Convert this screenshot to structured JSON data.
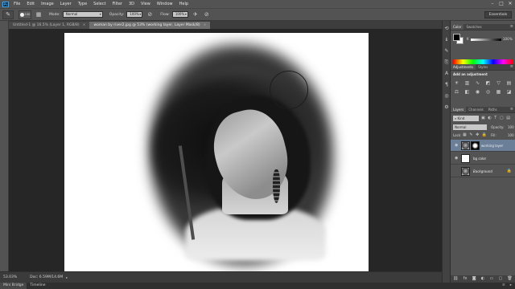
{
  "app": {
    "logo": "Ps"
  },
  "menu": [
    "File",
    "Edit",
    "Image",
    "Layer",
    "Type",
    "Select",
    "Filter",
    "3D",
    "View",
    "Window",
    "Help"
  ],
  "window_controls": [
    "–",
    "□",
    "✕"
  ],
  "options": {
    "brush_size": "100",
    "mode_label": "Mode:",
    "mode_value": "Normal",
    "opacity_label": "Opacity:",
    "opacity_value": "100%",
    "flow_label": "Flow:",
    "flow_value": "100%",
    "workspace": "Essentials"
  },
  "documents": {
    "tabs": [
      {
        "label": "Untitled-1 @ 16.5% (Layer 1, RGB/8)"
      },
      {
        "label": "woman by river2.jpg @ 53% (working layer, Layer Mask/8)"
      }
    ],
    "close_glyph": "×"
  },
  "status": {
    "zoom": "53.03%",
    "doc_info": "Doc: 6.59M/14.6M",
    "arrow": "▸"
  },
  "bottom_tabs": [
    "Mini Bridge",
    "Timeline"
  ],
  "panels": {
    "color": {
      "tabs": [
        "Color",
        "Swatches"
      ],
      "channel_label": "K",
      "channel_value": "100",
      "unit": "%",
      "foreground": "#000000",
      "background": "#ffffff"
    },
    "adjustments": {
      "tabs": [
        "Adjustments",
        "Styles"
      ],
      "title": "Add an adjustment"
    },
    "layers": {
      "tabs": [
        "Layers",
        "Channels",
        "Paths"
      ],
      "filter_kind": "Kind",
      "blend_mode": "Normal",
      "opacity_label": "Opacity:",
      "opacity_value": "100",
      "lock_label": "Lock:",
      "fill_label": "Fill:",
      "fill_value": "100",
      "items": [
        {
          "name": "working layer",
          "selected": true
        },
        {
          "name": "bg color",
          "selected": false
        },
        {
          "name": "Background",
          "selected": false
        }
      ]
    }
  },
  "colors": {
    "menubar": "#535353",
    "canvas_bg": "#262626",
    "selected_layer": "#6b7f99",
    "accent": "#31a8ff"
  }
}
